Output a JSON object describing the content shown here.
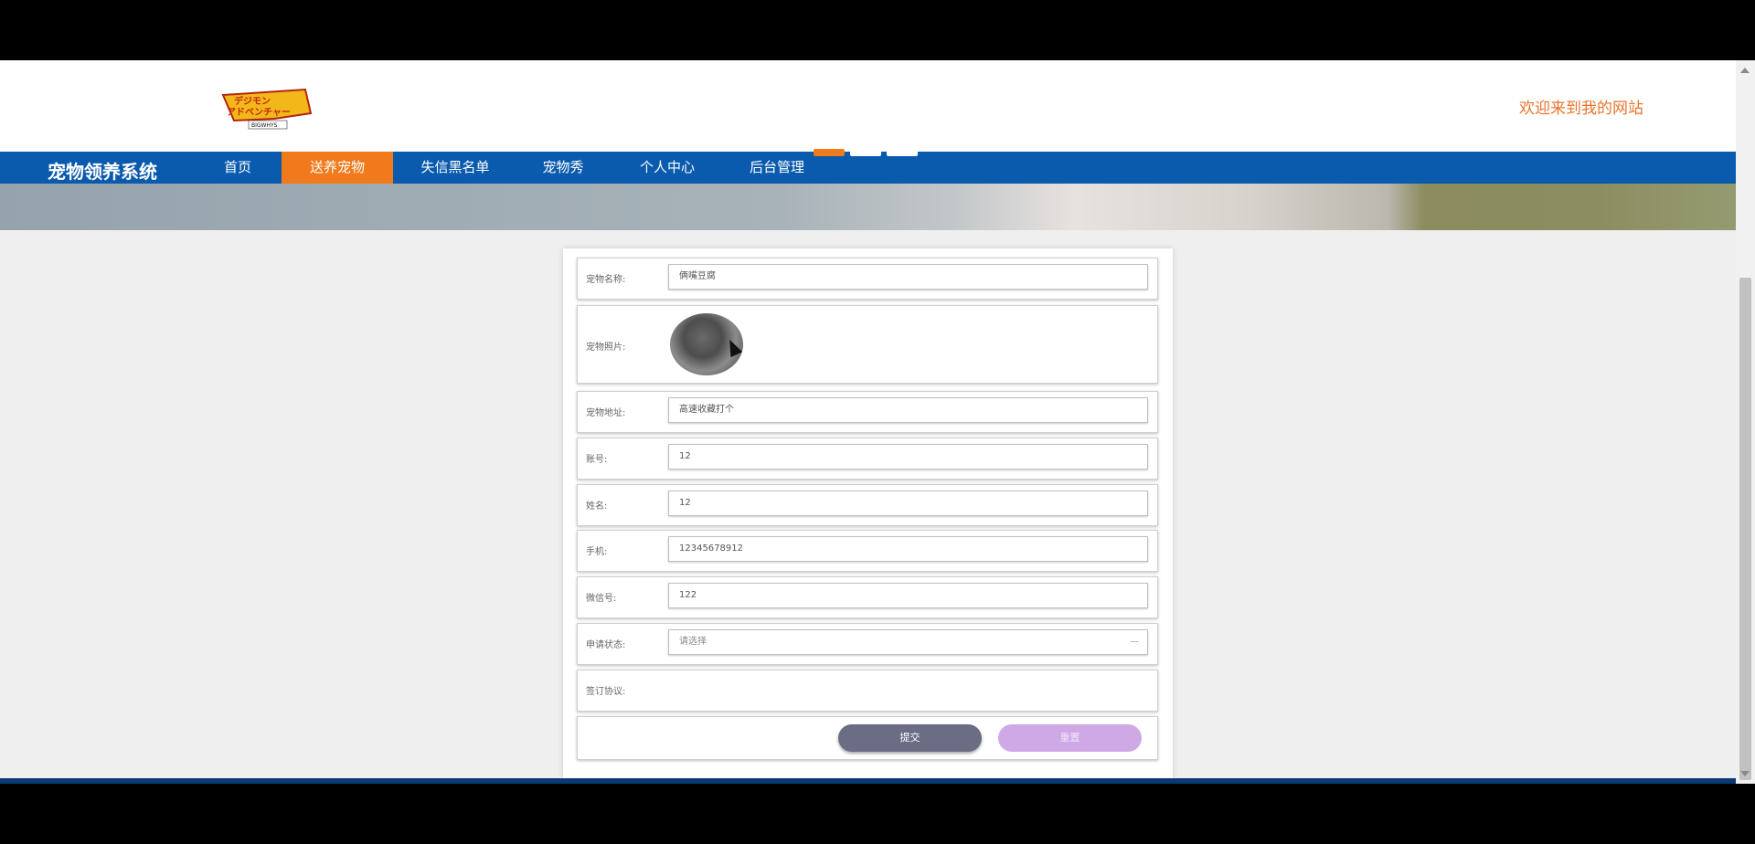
{
  "header": {
    "welcome": "欢迎来到我的网站",
    "logo_text": "BIGWHYS"
  },
  "nav": {
    "brand": "宠物领养系统",
    "items": [
      {
        "label": "首页",
        "active": false
      },
      {
        "label": "送养宠物",
        "active": true
      },
      {
        "label": "失信黑名单",
        "active": false
      },
      {
        "label": "宠物秀",
        "active": false
      },
      {
        "label": "个人中心",
        "active": false
      },
      {
        "label": "后台管理",
        "active": false
      }
    ]
  },
  "banner": {
    "slides": 3,
    "active_slide": 1
  },
  "form": {
    "pet_name": {
      "label": "宠物名称:",
      "value": "俩嘴豆腐"
    },
    "pet_photo": {
      "label": "宠物照片:"
    },
    "pet_address": {
      "label": "宠物地址:",
      "value": "高速收藏打个"
    },
    "account": {
      "label": "账号:",
      "value": "12"
    },
    "name": {
      "label": "姓名:",
      "value": "12"
    },
    "phone": {
      "label": "手机:",
      "value": "12345678912"
    },
    "wechat": {
      "label": "微信号:",
      "value": "122"
    },
    "status": {
      "label": "申请状态:",
      "value": "请选择"
    },
    "agreement": {
      "label": "签订协议:"
    },
    "submit_label": "提交",
    "reset_label": "重置"
  },
  "colors": {
    "nav_bg": "#0a5aad",
    "accent": "#f07a1c",
    "submit": "#6b6d85",
    "reset": "#cfa8e6"
  }
}
